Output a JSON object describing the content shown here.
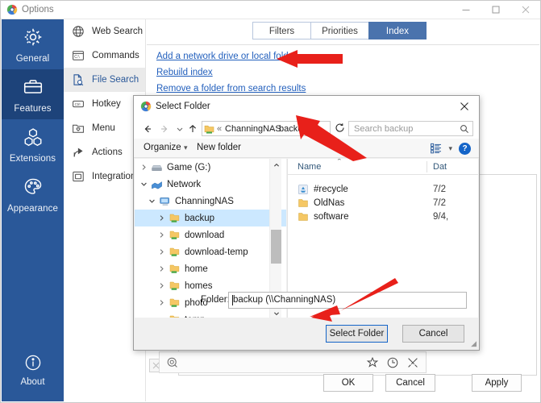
{
  "window": {
    "title": "Options",
    "app_icon": "search-globe-icon",
    "controls": {
      "minimize": "minimize-icon",
      "maximize": "maximize-icon",
      "close": "close-icon"
    }
  },
  "rail": {
    "items": [
      {
        "label": "General",
        "icon": "gear-icon",
        "selected": false
      },
      {
        "label": "Features",
        "icon": "briefcase-icon",
        "selected": true
      },
      {
        "label": "Extensions",
        "icon": "puzzle-cube-icon",
        "selected": false
      },
      {
        "label": "Appearance",
        "icon": "palette-icon",
        "selected": false
      }
    ],
    "about": {
      "label": "About",
      "icon": "info-icon"
    },
    "accent": "#2a5899",
    "selected_bg": "#1d437a"
  },
  "subnav": {
    "items": [
      {
        "label": "Web Search",
        "icon": "globe-icon",
        "selected": false
      },
      {
        "label": "Commands",
        "icon": "command-box-icon",
        "selected": false
      },
      {
        "label": "File Search",
        "icon": "file-search-icon",
        "selected": true
      },
      {
        "label": "Hotkey",
        "icon": "key-icon",
        "selected": false
      },
      {
        "label": "Menu",
        "icon": "menu-folder-icon",
        "selected": false
      },
      {
        "label": "Actions",
        "icon": "share-arrow-icon",
        "selected": false
      },
      {
        "label": "Integration",
        "icon": "window-copy-icon",
        "selected": false
      }
    ]
  },
  "content": {
    "tabs": [
      {
        "label": "Filters",
        "active": false
      },
      {
        "label": "Priorities",
        "active": false
      },
      {
        "label": "Index",
        "active": true
      }
    ],
    "links": [
      {
        "label": "Add a network drive or local folder"
      },
      {
        "label": "Rebuild index"
      },
      {
        "label": "Remove a folder from search results"
      }
    ],
    "buttons": {
      "ok": "OK",
      "cancel": "Cancel",
      "apply": "Apply"
    }
  },
  "background_searchbar": {
    "logo_icon": "search-globe-icon",
    "star_icon": "star-icon",
    "clock_icon": "clock-icon",
    "tools_icon": "tools-icon",
    "close_icon": "close-icon"
  },
  "dialog": {
    "title": "Select Folder",
    "title_icon": "search-globe-icon",
    "close_icon": "close-icon",
    "nav": {
      "back_icon": "arrow-left-icon",
      "forward_icon": "arrow-right-icon",
      "recent_icon": "chevron-down-icon",
      "up_icon": "arrow-up-icon",
      "refresh_icon": "refresh-icon",
      "dropdown_icon": "chevron-down-icon"
    },
    "breadcrumb": {
      "drive_icon": "network-folder-icon",
      "sep0": "«",
      "item1": "ChanningNAS",
      "sep1": "›",
      "item2": "backup",
      "sep2": "›"
    },
    "search": {
      "placeholder": "Search backup",
      "icon": "search-icon"
    },
    "toolbar": {
      "organize": "Organize",
      "organize_caret": "▾",
      "new_folder": "New folder",
      "view_icon": "view-list-icon",
      "view_caret": "▾",
      "help_icon": "help-icon",
      "help_glyph": "?"
    },
    "tree": [
      {
        "label": "Game (G:)",
        "icon": "disk-icon",
        "indent": 0,
        "twisty": "collapsed",
        "selected": false
      },
      {
        "label": "Network",
        "icon": "network-icon",
        "indent": 0,
        "twisty": "expanded",
        "selected": false
      },
      {
        "label": "ChanningNAS",
        "icon": "computer-icon",
        "indent": 1,
        "twisty": "expanded",
        "selected": false
      },
      {
        "label": "backup",
        "icon": "network-folder-icon",
        "indent": 2,
        "twisty": "collapsed",
        "selected": true
      },
      {
        "label": "download",
        "icon": "network-folder-icon",
        "indent": 2,
        "twisty": "collapsed",
        "selected": false
      },
      {
        "label": "download-temp",
        "icon": "network-folder-icon",
        "indent": 2,
        "twisty": "collapsed",
        "selected": false
      },
      {
        "label": "home",
        "icon": "network-folder-icon",
        "indent": 2,
        "twisty": "collapsed",
        "selected": false
      },
      {
        "label": "homes",
        "icon": "network-folder-icon",
        "indent": 2,
        "twisty": "collapsed",
        "selected": false
      },
      {
        "label": "photo",
        "icon": "network-folder-icon",
        "indent": 2,
        "twisty": "collapsed",
        "selected": false
      },
      {
        "label": "temp",
        "icon": "network-folder-icon",
        "indent": 2,
        "twisty": "expanded",
        "selected": false
      }
    ],
    "list": {
      "columns": {
        "name": "Name",
        "date": "Dat"
      },
      "sort_caret": "⌃",
      "rows": [
        {
          "name": "#recycle",
          "icon": "recycle-icon",
          "date": "7/2"
        },
        {
          "name": "OldNas",
          "icon": "folder-icon",
          "date": "7/2"
        },
        {
          "name": "software",
          "icon": "folder-icon",
          "date": "9/4,"
        }
      ]
    },
    "hscroll": {
      "left_glyph": "‹",
      "right_glyph": "›"
    },
    "folder_field": {
      "label": "Folder:",
      "value": "backup (\\\\ChanningNAS)"
    },
    "buttons": {
      "select": "Select Folder",
      "cancel": "Cancel"
    }
  },
  "annotations": {
    "arrow_color": "#e8201a",
    "arrows": [
      {
        "name": "arrow-to-add-network-drive-link"
      },
      {
        "name": "arrow-to-breadcrumb"
      },
      {
        "name": "arrow-to-folder-field"
      }
    ]
  }
}
